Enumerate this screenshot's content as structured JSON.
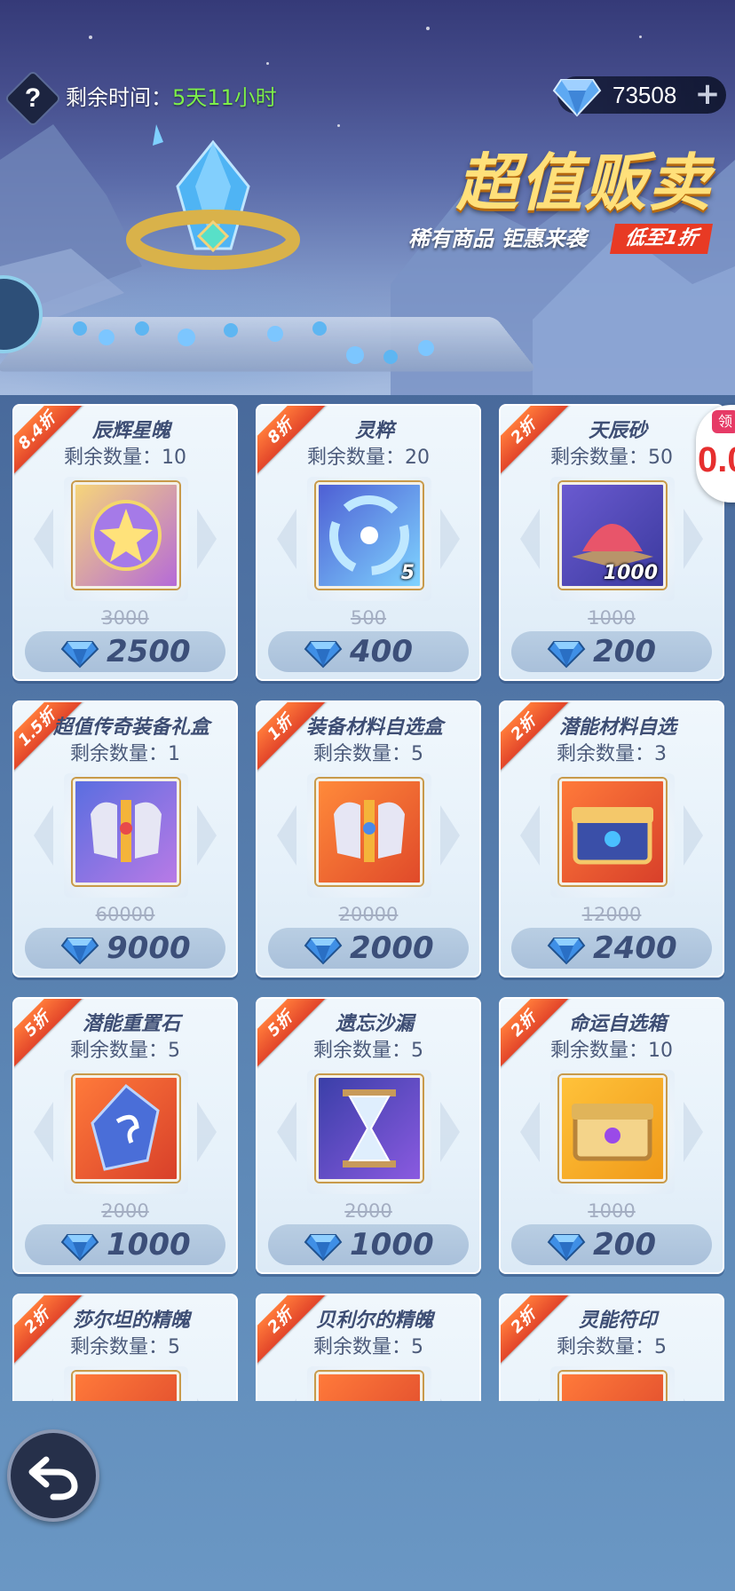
{
  "header": {
    "help_icon": "question-icon",
    "time_label": "剩余时间：",
    "time_value": "5天11小时",
    "currency_icon": "diamond-icon",
    "currency_amount": "73508",
    "currency_plus": "+"
  },
  "promo": {
    "title": "超值贩卖",
    "subtitle": "稀有商品 钜惠来袭",
    "tag": "低至1折"
  },
  "side_widget": {
    "label": "领",
    "value": "0.0"
  },
  "items": [
    {
      "discount": "8.4折",
      "name": "辰辉星魄",
      "stock": "剩余数量：10",
      "qty": "",
      "old_price": "3000",
      "price": "2500",
      "icon": "star-orb-icon"
    },
    {
      "discount": "8折",
      "name": "灵粹",
      "stock": "剩余数量：20",
      "qty": "5",
      "old_price": "500",
      "price": "400",
      "icon": "spirit-swirl-icon"
    },
    {
      "discount": "2折",
      "name": "天辰砂",
      "stock": "剩余数量：50",
      "qty": "1000",
      "old_price": "1000",
      "price": "200",
      "icon": "red-sand-icon"
    },
    {
      "discount": "1.5折",
      "name": "超值传奇装备礼盒",
      "stock": "剩余数量：1",
      "qty": "",
      "old_price": "60000",
      "price": "9000",
      "icon": "armor-box-icon"
    },
    {
      "discount": "1折",
      "name": "装备材料自选盒",
      "stock": "剩余数量：5",
      "qty": "",
      "old_price": "20000",
      "price": "2000",
      "icon": "armor-select-icon"
    },
    {
      "discount": "2折",
      "name": "潜能材料自选",
      "stock": "剩余数量：3",
      "qty": "",
      "old_price": "12000",
      "price": "2400",
      "icon": "blue-chest-icon"
    },
    {
      "discount": "5折",
      "name": "潜能重置石",
      "stock": "剩余数量：5",
      "qty": "",
      "old_price": "2000",
      "price": "1000",
      "icon": "reset-stone-icon"
    },
    {
      "discount": "5折",
      "name": "遗忘沙漏",
      "stock": "剩余数量：5",
      "qty": "",
      "old_price": "2000",
      "price": "1000",
      "icon": "hourglass-icon"
    },
    {
      "discount": "2折",
      "name": "命运自选箱",
      "stock": "剩余数量：10",
      "qty": "",
      "old_price": "1000",
      "price": "200",
      "icon": "gold-chest-icon"
    },
    {
      "discount": "2折",
      "name": "莎尔坦的精魄",
      "stock": "剩余数量：5",
      "qty": "",
      "old_price": "",
      "price": "",
      "icon": "dark-orb-icon"
    },
    {
      "discount": "2折",
      "name": "贝利尔的精魄",
      "stock": "剩余数量：5",
      "qty": "",
      "old_price": "",
      "price": "",
      "icon": "red-orb-icon"
    },
    {
      "discount": "2折",
      "name": "灵能符印",
      "stock": "剩余数量：5",
      "qty": "",
      "old_price": "",
      "price": "",
      "icon": "rune-seal-icon"
    }
  ],
  "footer": {
    "back_icon": "back-arrow-icon"
  },
  "colors": {
    "ribbon": "#e2452a",
    "time_value": "#7df04a",
    "price_text": "#3c4f79",
    "promo_title": "#ffe07a"
  }
}
